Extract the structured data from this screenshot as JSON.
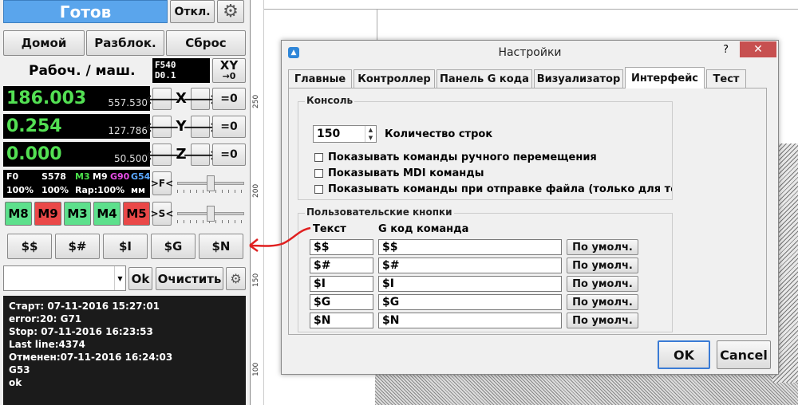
{
  "machine": {
    "state": "Готов",
    "disconnect_label": "Откл.",
    "home_label": "Домой",
    "unlock_label": "Разблок.",
    "reset_label": "Сброс",
    "coord_mode_label": "Рабоч. / маш.",
    "feed_info_1": "F540",
    "feed_info_2": "D0.1",
    "xy_zero_top": "XY",
    "xy_zero_bottom": "→0",
    "zero_label": "=0",
    "left_arrow": "🡐",
    "right_arrow": "🡒",
    "axes": [
      {
        "name": "X",
        "work": "186.003",
        "machine": "557.530"
      },
      {
        "name": "Y",
        "work": "0.254",
        "machine": "127.786"
      },
      {
        "name": "Z",
        "work": "0.000",
        "machine": "50.500"
      }
    ],
    "status": {
      "f": "F0",
      "s": "S578",
      "m3": "M3",
      "m9": "M9",
      "g90": "G90",
      "g54": "G54",
      "fpct": "100%",
      "spct": "100%",
      "rap": "Rap:100%",
      "mm": "мм"
    },
    "feed_override_label": ">F<",
    "spindle_override_label": ">S<",
    "feed_override_level": 0.5,
    "spindle_override_level": 0.5,
    "mcodes": [
      {
        "label": "M8",
        "color": "#5de08c"
      },
      {
        "label": "M9",
        "color": "#ea4848"
      },
      {
        "label": "M3",
        "color": "#5de08c"
      },
      {
        "label": "M4",
        "color": "#5de08c"
      },
      {
        "label": "M5",
        "color": "#ea4848"
      }
    ],
    "custom_buttons": [
      "$$",
      "$#",
      "$I",
      "$G",
      "$N"
    ],
    "command_value": "",
    "ok_label": "Ok",
    "clear_label": "Очистить",
    "console_lines": [
      "Старт: 07-11-2016 15:27:01",
      "error:20: G71",
      "Stop: 07-11-2016 16:23:53",
      "Last line:4374",
      "Отменен:07-11-2016 16:24:03",
      "G53",
      "ok"
    ]
  },
  "ruler": {
    "labels": [
      "250",
      "200",
      "150",
      "100"
    ]
  },
  "dialog": {
    "title": "Настройки",
    "help": "?",
    "close": "✕",
    "tabs": [
      "Главные",
      "Контроллер",
      "Панель G кода",
      "Визуализатор",
      "Интерфейс",
      "Тест"
    ],
    "active_tab": "Интерфейс",
    "console_group": "Консоль",
    "line_count": "150",
    "line_count_label": "Количество строк",
    "checks": [
      {
        "label": "Показывать команды ручного перемещения",
        "checked": false
      },
      {
        "label": "Показывать MDI команды",
        "checked": false
      },
      {
        "label": "Показывать команды при отправке файла (только для те",
        "checked": false
      }
    ],
    "custom_group": "Пользовательские кнопки",
    "col_text": "Текст",
    "col_gcode": "G код команда",
    "default_label": "По умолч.",
    "rows": [
      {
        "text": "$$",
        "gcode": "$$"
      },
      {
        "text": "$#",
        "gcode": "$#"
      },
      {
        "text": "$I",
        "gcode": "$I"
      },
      {
        "text": "$G",
        "gcode": "$G"
      },
      {
        "text": "$N",
        "gcode": "$N"
      }
    ],
    "ok": "OK",
    "cancel": "Cancel"
  }
}
